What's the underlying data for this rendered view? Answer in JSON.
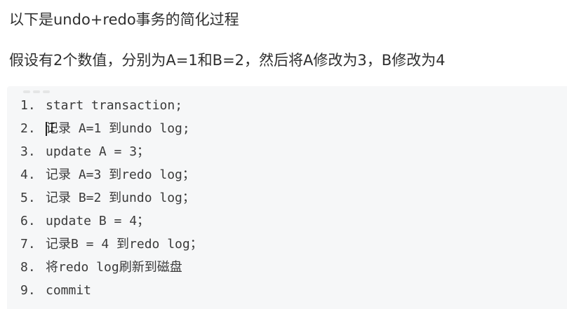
{
  "paragraphs": {
    "line1": "以下是undo+redo事务的简化过程",
    "line2": "假设有2个数值，分别为A=1和B=2，然后将A修改为3，B修改为4"
  },
  "code": {
    "lines": [
      {
        "num": "1.",
        "text": "start transaction;"
      },
      {
        "num": "2.",
        "text": "记录 A=1 到undo log;"
      },
      {
        "num": "3.",
        "text": "update A = 3；"
      },
      {
        "num": "4.",
        "text": "记录 A=3 到redo log；"
      },
      {
        "num": "5.",
        "text": "记录 B=2 到undo log；"
      },
      {
        "num": "6.",
        "text": "update B = 4；"
      },
      {
        "num": "7.",
        "text": "记录B = 4 到redo log；"
      },
      {
        "num": "8.",
        "text": "将redo log刷新到磁盘"
      },
      {
        "num": "9.",
        "text": "commit"
      }
    ]
  }
}
